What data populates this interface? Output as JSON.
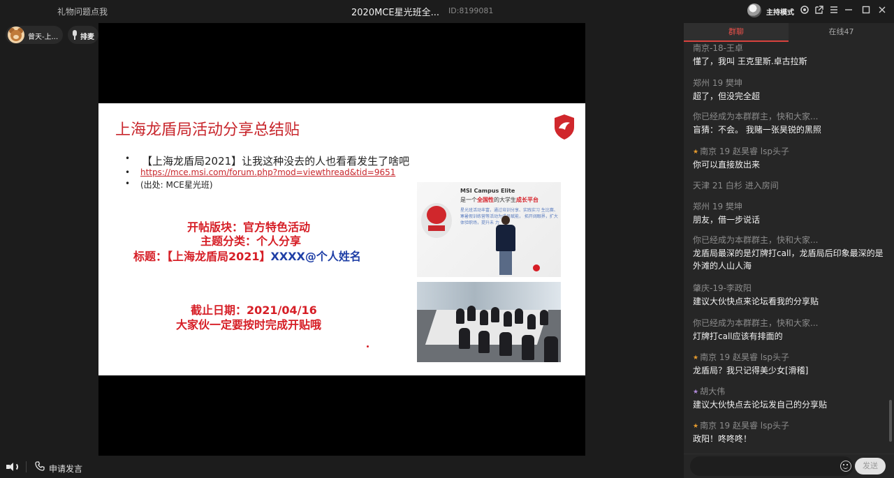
{
  "topbar": {
    "gift_link": "礼物问题点我",
    "room_title": "2020MCE星光班全...",
    "room_id": "ID:8199081",
    "host_mode": "主持模式"
  },
  "participants": {
    "user_name": "曾天-上...",
    "queue_label": "排麦"
  },
  "slide": {
    "title": "上海龙盾局活动分享总结贴",
    "bullet1": "【上海龙盾局2021】让我这种没去的人也看看发生了啥吧",
    "bullet2": "https://mce.msi.com/forum.php?mod=viewthread&tid=9651",
    "bullet3": "(出处: MCE星光班)",
    "line1": "开帖版块：官方特色活动",
    "line2": "主题分类：个人分享",
    "line3_red": "标题：【上海龙盾局2021】",
    "line3_blue": "XXXX@个人姓名",
    "line4": "截止日期：2021/04/16",
    "line5": "大家伙一定要按时完成开贴哦",
    "photo1_head": "MSI Campus Elite",
    "photo1_sub_a": "是一个",
    "photo1_sub_hl1": "全国性",
    "photo1_sub_b": "的大学生",
    "photo1_sub_hl2": "成长平台",
    "photo1_lines": "星光班活动丰富，通过培训分享、实践实习 生比赛、寒暑假训练营等活动为成员赋能， 拓开阔眼界，扩大 体验职场，提升未 力"
  },
  "chat": {
    "tab_group": "群聊",
    "tab_online": "在线47",
    "input_placeholder": "",
    "send_label": "发送",
    "messages": [
      {
        "name": "南京-18-王卓",
        "text": "懂了，我叫 王克里斯.卓古拉斯",
        "star": ""
      },
      {
        "name": "郑州 19 樊坤",
        "text": "超了，但没完全超",
        "star": ""
      },
      {
        "name": "你已经成为本群群主，快和大家...",
        "text": "盲猜：不会。 我赌一张昊锐的黑照",
        "star": ""
      },
      {
        "name": "南京 19 赵昊睿 lsp头子",
        "text": "你可以直接放出来",
        "star": "orange"
      },
      {
        "name": "天津 21 白杉 进入房间",
        "text": "",
        "star": ""
      },
      {
        "name": "郑州 19 樊坤",
        "text": "朋友，借一步说话",
        "star": ""
      },
      {
        "name": "你已经成为本群群主，快和大家...",
        "text": "龙盾局最深的是灯牌打call，龙盾局后印象最深的是外滩的人山人海",
        "star": ""
      },
      {
        "name": "肇庆-19-李政阳",
        "text": "建议大伙快点来论坛看我的分享贴",
        "star": ""
      },
      {
        "name": "你已经成为本群群主，快和大家...",
        "text": "灯牌打call应该有排面的",
        "star": ""
      },
      {
        "name": "南京 19 赵昊睿 lsp头子",
        "text": "龙盾局？我只记得美少女[滑稽]",
        "star": "orange"
      },
      {
        "name": "胡大伟",
        "text": "建议大伙快点去论坛发自己的分享贴",
        "star": "purple"
      },
      {
        "name": "南京 19 赵昊睿 lsp头子",
        "text": "政阳！咚咚咚！",
        "star": "orange"
      }
    ]
  },
  "bottom": {
    "apply_speak": "申请发言"
  },
  "colors": {
    "accent_red": "#d8423d",
    "slide_red": "#c8262c",
    "slide_blue": "#1f3fa6",
    "panel_bg": "#262626"
  },
  "icons": {
    "host": "host-avatar-icon",
    "settings": "settings-icon",
    "popout": "popout-icon",
    "menu": "menu-icon",
    "minimize": "minimize-icon",
    "maximize": "maximize-icon",
    "close": "close-icon",
    "speaker": "speaker-icon",
    "phone": "phone-icon",
    "emoji": "emoji-icon",
    "mic": "mic-icon"
  }
}
